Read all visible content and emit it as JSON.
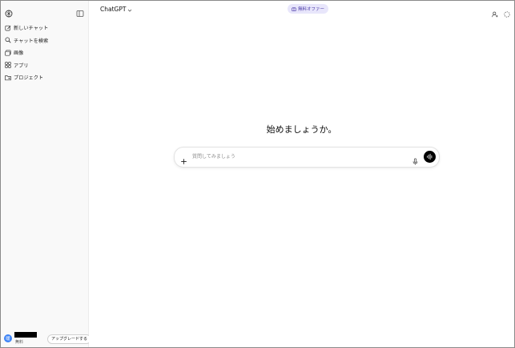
{
  "sidebar": {
    "items": [
      {
        "label": "新しいチャット",
        "icon": "edit-icon"
      },
      {
        "label": "チャットを検索",
        "icon": "search-icon"
      },
      {
        "label": "画像",
        "icon": "image-icon"
      },
      {
        "label": "アプリ",
        "icon": "apps-icon"
      },
      {
        "label": "プロジェクト",
        "icon": "folder-icon"
      }
    ],
    "user": {
      "avatar_initial": "暖",
      "plan": "無料",
      "upgrade_label": "アップグレードする"
    }
  },
  "header": {
    "model_name": "ChatGPT",
    "offer_label": "無料オファー"
  },
  "main": {
    "heading": "始めましょうか。",
    "composer": {
      "placeholder": "質問してみましょう"
    }
  },
  "colors": {
    "sidebar_bg": "#f9f9f9",
    "offer_bg": "#e8e6fb",
    "offer_text": "#4b3ba8",
    "avatar_bg": "#3b82f6"
  }
}
